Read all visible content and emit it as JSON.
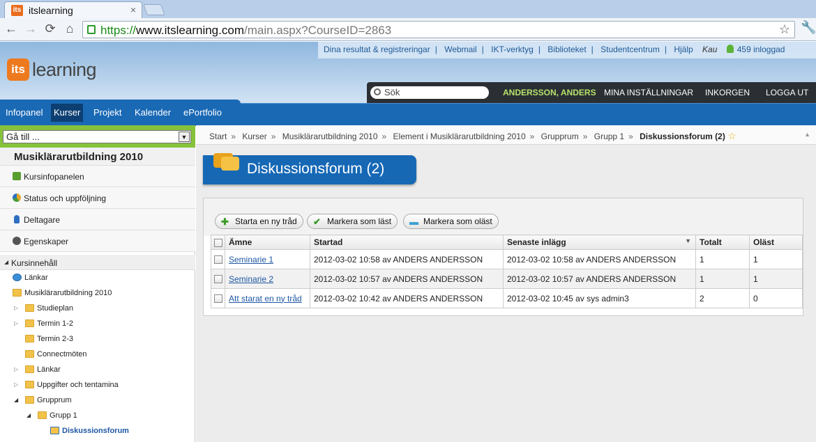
{
  "browser": {
    "tab_title": "itslearning",
    "tab_favicon": "its",
    "url_scheme": "https://",
    "url_host": "www.itslearning.com",
    "url_path": "/main.aspx?CourseID=2863"
  },
  "header": {
    "logo_its": "its",
    "logo_learning": "learning",
    "top_links": [
      "Dina resultat & registreringar",
      "Webmail",
      "IKT-verktyg",
      "Biblioteket",
      "Studentcentrum",
      "Hjälp"
    ],
    "org": "Kau",
    "online_count": "459 inloggad",
    "search_placeholder": "Sök",
    "user_name": "ANDERSSON, ANDERS",
    "settings": "MINA INSTÄLLNINGAR",
    "inbox": "INKORGEN",
    "logout": "LOGGA UT",
    "nav": [
      "Infopanel",
      "Kurser",
      "Projekt",
      "Kalender",
      "ePortfolio"
    ],
    "active_nav": "Kurser"
  },
  "sidebar": {
    "goto": "Gå till ...",
    "course_title": "Musiklärarutbildning 2010",
    "items": [
      {
        "label": "Kursinfopanelen",
        "icon": "course-info-icon",
        "color": "#5a9e2f"
      },
      {
        "label": "Status och uppföljning",
        "icon": "status-pie-icon",
        "color": "#e3a72b"
      },
      {
        "label": "Deltagare",
        "icon": "person-icon",
        "color": "#2f6fc1"
      },
      {
        "label": "Egenskaper",
        "icon": "gear-icon",
        "color": "#555555"
      }
    ],
    "content_header": "Kursinnehåll",
    "tree": [
      {
        "label": "Länkar",
        "icon": "globe-icon"
      },
      {
        "label": "Musiklärarutbildning 2010",
        "icon": "folder-icon"
      },
      {
        "label": "Studieplan",
        "icon": "folder-icon"
      },
      {
        "label": "Termin 1-2",
        "icon": "folder-icon"
      },
      {
        "label": "Termin 2-3",
        "icon": "folder-icon"
      },
      {
        "label": "Connectmöten",
        "icon": "folder-icon"
      },
      {
        "label": "Länkar",
        "icon": "folder-icon"
      },
      {
        "label": "Uppgifter och tentamina",
        "icon": "folder-icon"
      },
      {
        "label": "Grupprum",
        "icon": "folder-icon"
      },
      {
        "label": "Grupp 1",
        "icon": "folder-icon"
      },
      {
        "label": "Diskussionsforum",
        "icon": "forum-icon"
      }
    ]
  },
  "breadcrumb": [
    "Start",
    "Kurser",
    "Musiklärarutbildning 2010",
    "Element i Musiklärarutbildning 2010",
    "Grupprum",
    "Grupp 1"
  ],
  "breadcrumb_current": "Diskussionsforum (2)",
  "page_title": "Diskussionsforum (2)",
  "actions": {
    "new_thread": "Starta en ny tråd",
    "mark_read": "Markera som läst",
    "mark_unread": "Markera som oläst"
  },
  "table": {
    "columns": [
      "Ämne",
      "Startad",
      "Senaste inlägg",
      "Totalt",
      "Oläst"
    ],
    "rows": [
      {
        "subject": "Seminarie 1",
        "started": "2012-03-02 10:58 av ANDERS ANDERSSON",
        "latest": "2012-03-02 10:58 av ANDERS ANDERSSON",
        "total": "1",
        "unread": "1"
      },
      {
        "subject": "Seminarie 2",
        "started": "2012-03-02 10:57 av ANDERS ANDERSSON",
        "latest": "2012-03-02 10:57 av ANDERS ANDERSSON",
        "total": "1",
        "unread": "1"
      },
      {
        "subject": "Att starat en ny tråd",
        "started": "2012-03-02 10:42 av ANDERS ANDERSSON",
        "latest": "2012-03-02 10:45 av sys admin3",
        "total": "2",
        "unread": "0"
      }
    ]
  }
}
